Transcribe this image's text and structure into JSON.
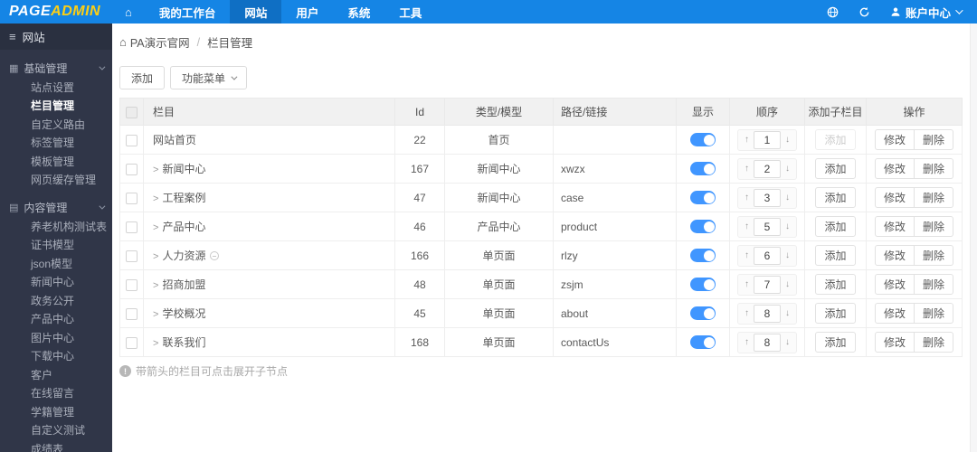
{
  "topbar": {
    "logo_part1": "PAGE",
    "logo_part2": "ADMIN",
    "nav": [
      {
        "label": "我的工作台",
        "active": false
      },
      {
        "label": "网站",
        "active": true
      },
      {
        "label": "用户",
        "active": false
      },
      {
        "label": "系统",
        "active": false
      },
      {
        "label": "工具",
        "active": false
      }
    ],
    "account_label": "账户中心"
  },
  "sidebar": {
    "header": "网站",
    "groups": [
      {
        "label": "基础管理",
        "icon": "grid-icon",
        "items": [
          "站点设置",
          "栏目管理",
          "自定义路由",
          "标签管理",
          "模板管理",
          "网页缓存管理"
        ],
        "active_item": "栏目管理"
      },
      {
        "label": "内容管理",
        "icon": "document-icon",
        "items": [
          "养老机构测试表",
          "证书模型",
          "json模型",
          "新闻中心",
          "政务公开",
          "产品中心",
          "图片中心",
          "下载中心",
          "客户",
          "在线留言",
          "学籍管理",
          "自定义测试",
          "成绩表"
        ],
        "active_item": ""
      }
    ]
  },
  "breadcrumb": {
    "site": "PA演示官网",
    "separator": "/",
    "page": "栏目管理"
  },
  "toolbar": {
    "add_label": "添加",
    "menu_label": "功能菜单"
  },
  "table": {
    "headers": [
      "栏目",
      "Id",
      "类型/模型",
      "路径/链接",
      "显示",
      "顺序",
      "添加子栏目",
      "操作"
    ],
    "buttons": {
      "add_child": "添加",
      "modify": "修改",
      "delete": "删除"
    },
    "rows": [
      {
        "name": "网站首页",
        "has_arrow": false,
        "has_indicator": false,
        "id": "22",
        "type": "首页",
        "path": "",
        "visible": true,
        "order": "1",
        "add_disabled": true
      },
      {
        "name": "新闻中心",
        "has_arrow": true,
        "has_indicator": false,
        "id": "167",
        "type": "新闻中心",
        "path": "xwzx",
        "visible": true,
        "order": "2",
        "add_disabled": false
      },
      {
        "name": "工程案例",
        "has_arrow": true,
        "has_indicator": false,
        "id": "47",
        "type": "新闻中心",
        "path": "case",
        "visible": true,
        "order": "3",
        "add_disabled": false
      },
      {
        "name": "产品中心",
        "has_arrow": true,
        "has_indicator": false,
        "id": "46",
        "type": "产品中心",
        "path": "product",
        "visible": true,
        "order": "5",
        "add_disabled": false
      },
      {
        "name": "人力资源",
        "has_arrow": true,
        "has_indicator": true,
        "id": "166",
        "type": "单页面",
        "path": "rlzy",
        "visible": true,
        "order": "6",
        "add_disabled": false
      },
      {
        "name": "招商加盟",
        "has_arrow": true,
        "has_indicator": false,
        "id": "48",
        "type": "单页面",
        "path": "zsjm",
        "visible": true,
        "order": "7",
        "add_disabled": false
      },
      {
        "name": "学校概况",
        "has_arrow": true,
        "has_indicator": false,
        "id": "45",
        "type": "单页面",
        "path": "about",
        "visible": true,
        "order": "8",
        "add_disabled": false
      },
      {
        "name": "联系我们",
        "has_arrow": true,
        "has_indicator": false,
        "id": "168",
        "type": "单页面",
        "path": "contactUs",
        "visible": true,
        "order": "8",
        "add_disabled": false
      }
    ]
  },
  "footer_note": "带箭头的栏目可点击展开子节点",
  "icons": {
    "home": "⌂",
    "hamburger": "≡",
    "grid": "▦",
    "document": "▤",
    "row_arrow": ">",
    "up_arrow": "↑",
    "down_arrow": "↓",
    "info": "!"
  },
  "colors": {
    "topbar_blue": "#1585e5",
    "nav_active_blue": "#0f6fc4",
    "logo_yellow": "#ffcf12",
    "sidebar_dark": "#303648",
    "toggle_blue": "#4096ff"
  }
}
